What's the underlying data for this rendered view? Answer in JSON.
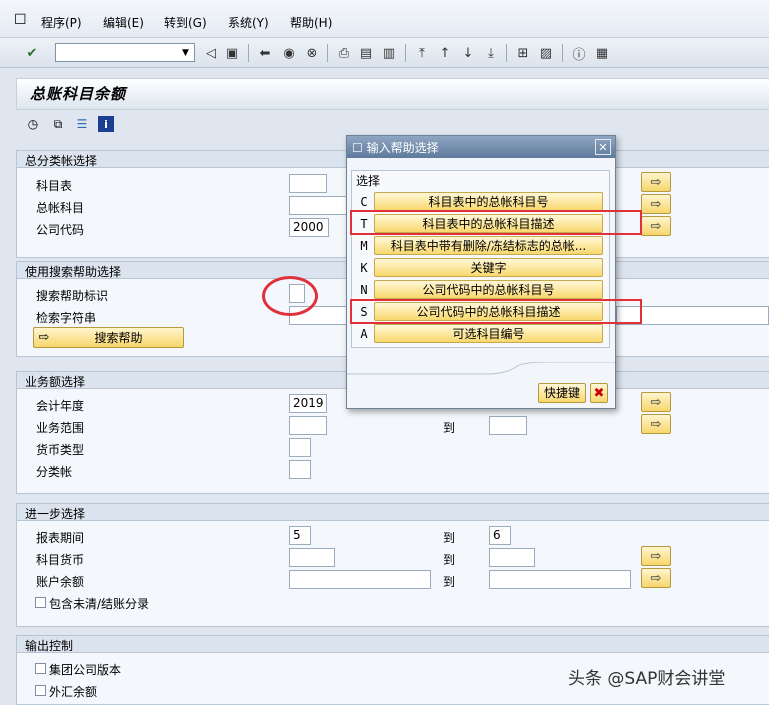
{
  "menubar": {
    "items": [
      "程序(P)",
      "编辑(E)",
      "转到(G)",
      "系统(Y)",
      "帮助(H)"
    ]
  },
  "page": {
    "title": "总账科目余额"
  },
  "groups": {
    "gl_select": {
      "title": "总分类帐选择",
      "chart_label": "科目表",
      "account_label": "总帐科目",
      "company_label": "公司代码",
      "company_value": "2000"
    },
    "search_help": {
      "title": "使用搜索帮助选择",
      "flag_label": "搜索帮助标识",
      "string_label": "检索字符串",
      "button_label": "搜索帮助"
    },
    "business": {
      "title": "业务额选择",
      "year_label": "会计年度",
      "year_value": "2019",
      "area_label": "业务范围",
      "to_label": "到",
      "currency_type_label": "货币类型",
      "ledger_label": "分类帐"
    },
    "further": {
      "title": "进一步选择",
      "period_label": "报表期间",
      "period_from": "5",
      "period_to_label": "到",
      "period_to": "6",
      "currency_label": "科目货币",
      "currency_to_label": "到",
      "balance_label": "账户余额",
      "balance_to_label": "到",
      "include_label": "包含未清/结账分录"
    },
    "output": {
      "title": "输出控制",
      "group_version_label": "集团公司版本",
      "fx_balance_label": "外汇余额"
    }
  },
  "dialog": {
    "title": "输入帮助选择",
    "section_title": "选择",
    "options": [
      {
        "key": "C",
        "label": "科目表中的总帐科目号"
      },
      {
        "key": "T",
        "label": "科目表中的总帐科目描述"
      },
      {
        "key": "M",
        "label": "科目表中带有删除/冻结标志的总帐..."
      },
      {
        "key": "K",
        "label": "关键字"
      },
      {
        "key": "N",
        "label": "公司代码中的总帐科目号"
      },
      {
        "key": "S",
        "label": "公司代码中的总帐科目描述"
      },
      {
        "key": "A",
        "label": "可选科目编号"
      }
    ],
    "shortcut_label": "快捷键"
  },
  "watermark": "头条 @SAP财会讲堂",
  "colors": {
    "accent_red": "#e0303a",
    "button_yellow": "#f7d66b",
    "dialog_header": "#5f7a9c"
  }
}
